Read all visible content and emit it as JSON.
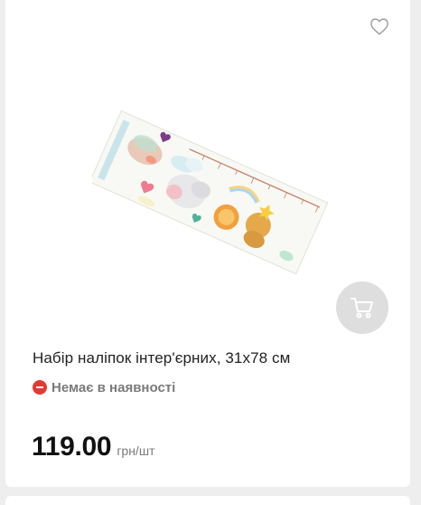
{
  "product": {
    "title": "Набір наліпок інтер'єрних, 31x78 см",
    "availability": "Немає в наявності",
    "price": "119.00",
    "price_unit": "грн/шт",
    "image_icon": "wall-sticker-set-image"
  },
  "actions": {
    "wishlist_icon": "heart-outline-icon",
    "cart_icon": "shopping-cart-icon"
  },
  "colors": {
    "cart_button_bg": "#dedede",
    "out_of_stock_dot": "#e53935",
    "muted_text": "#7a7a7a"
  }
}
